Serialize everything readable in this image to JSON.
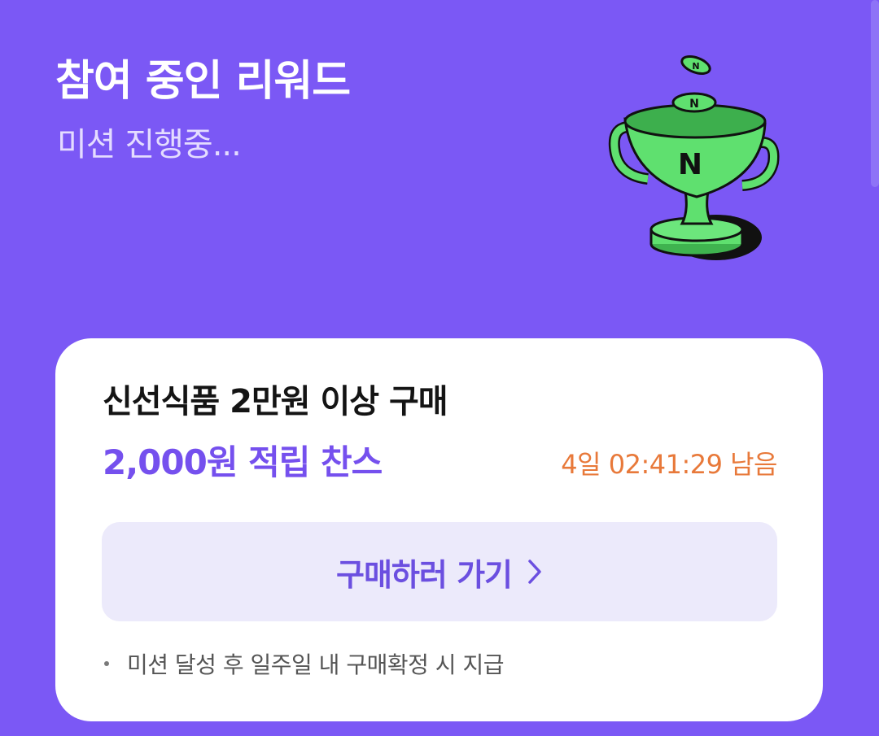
{
  "header": {
    "title": "참여 중인 리워드",
    "subtitle": "미션 진행중..."
  },
  "illustration": {
    "icon": "trophy-icon",
    "coin_symbol": "N",
    "colors": {
      "trophy": "#5FE06F",
      "outline": "#111111",
      "shadow": "#111111"
    }
  },
  "mission_card": {
    "title": "신선식품 2만원 이상 구매",
    "reward": "2,000원 적립 찬스",
    "countdown": "4일 02:41:29 남음",
    "cta_label": "구매하러 가기",
    "cta_icon": "chevron-right-icon",
    "footnote": "미션 달성 후 일주일 내 구매확정 시 지급"
  },
  "colors": {
    "background": "#7B58F5",
    "card": "#FFFFFF",
    "accent": "#7550EE",
    "countdown": "#E8793A",
    "button_bg": "#ECEAFB"
  }
}
